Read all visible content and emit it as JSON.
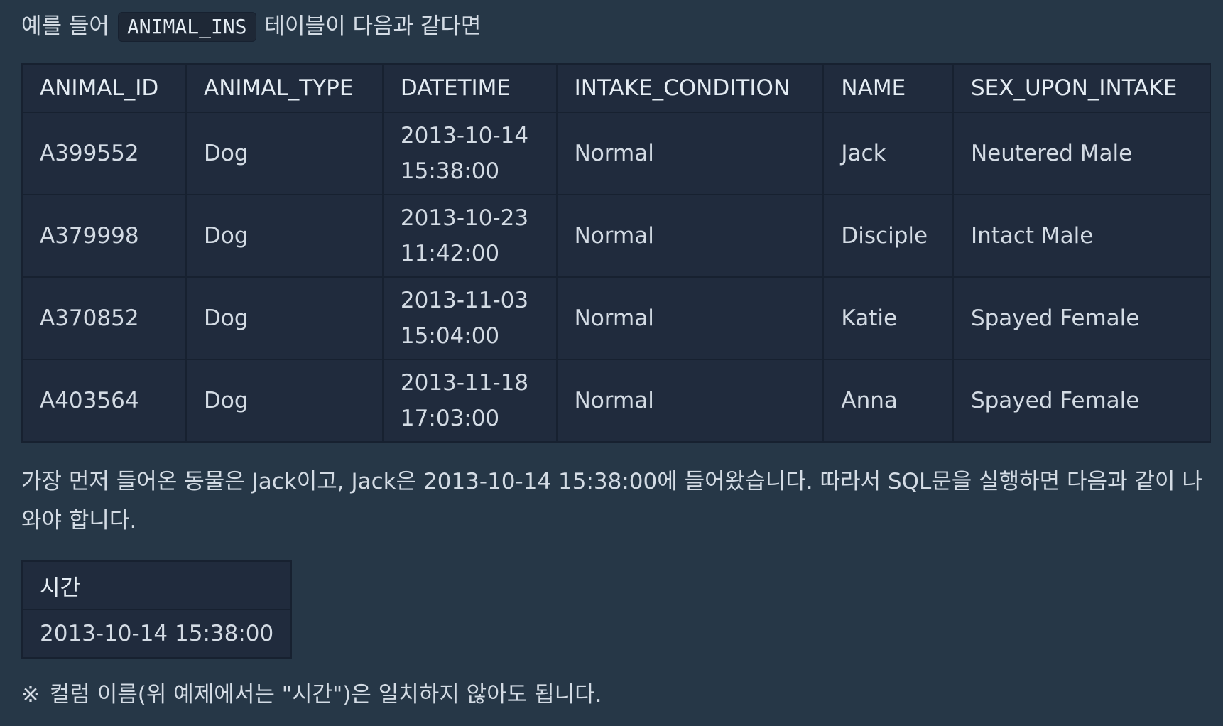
{
  "intro": {
    "before": "예를 들어",
    "code": "ANIMAL_INS",
    "after": "테이블이 다음과 같다면"
  },
  "animal_table": {
    "headers": [
      "ANIMAL_ID",
      "ANIMAL_TYPE",
      "DATETIME",
      "INTAKE_CONDITION",
      "NAME",
      "SEX_UPON_INTAKE"
    ],
    "rows": [
      {
        "animal_id": "A399552",
        "animal_type": "Dog",
        "date": "2013-10-14",
        "time": "15:38:00",
        "intake_condition": "Normal",
        "name": "Jack",
        "sex_upon_intake": "Neutered Male"
      },
      {
        "animal_id": "A379998",
        "animal_type": "Dog",
        "date": "2013-10-23",
        "time": "11:42:00",
        "intake_condition": "Normal",
        "name": "Disciple",
        "sex_upon_intake": "Intact Male"
      },
      {
        "animal_id": "A370852",
        "animal_type": "Dog",
        "date": "2013-11-03",
        "time": "15:04:00",
        "intake_condition": "Normal",
        "name": "Katie",
        "sex_upon_intake": "Spayed Female"
      },
      {
        "animal_id": "A403564",
        "animal_type": "Dog",
        "date": "2013-11-18",
        "time": "17:03:00",
        "intake_condition": "Normal",
        "name": "Anna",
        "sex_upon_intake": "Spayed Female"
      }
    ]
  },
  "explanation": {
    "line1": "가장 먼저 들어온 동물은 Jack이고, Jack은 2013-10-14 15:38:00에 들어왔습니다. 따라서 SQL문을 실행하면 다음과 같이 나",
    "line2": "와야 합니다."
  },
  "result_table": {
    "header": "시간",
    "value": "2013-10-14 15:38:00"
  },
  "note": {
    "mark": "※",
    "text": "컬럼 이름(위 예제에서는 \"시간\")은 일치하지 않아도 됩니다."
  },
  "colors": {
    "background": "#263747",
    "table_background": "#202b3d",
    "border": "#172130",
    "text": "#d3dbe4"
  }
}
